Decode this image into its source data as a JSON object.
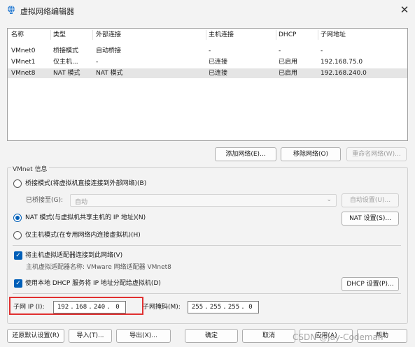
{
  "window": {
    "title": "虚拟网络编辑器",
    "close_glyph": "✕"
  },
  "table": {
    "columns": [
      "名称",
      "类型",
      "外部连接",
      "主机连接",
      "DHCP",
      "子网地址"
    ],
    "rows": [
      [
        "VMnet0",
        "桥接模式",
        "自动桥接",
        "-",
        "-",
        "-"
      ],
      [
        "VMnet1",
        "仅主机...",
        "-",
        "已连接",
        "已启用",
        "192.168.75.0"
      ],
      [
        "VMnet8",
        "NAT 模式",
        "NAT 模式",
        "已连接",
        "已启用",
        "192.168.240.0"
      ]
    ],
    "selected_row": 2
  },
  "network_buttons": {
    "add": "添加网络(E)...",
    "remove": "移除网络(O)",
    "rename": "重命名网络(W)..."
  },
  "vmnet_info": {
    "group_title": "VMnet 信息",
    "bridge_mode": "桥接模式(将虚拟机直接连接到外部网络)(B)",
    "bridged_to_label": "已桥接至(G):",
    "bridged_to_value": "自动",
    "auto_settings": "自动设置(U)...",
    "nat_mode": "NAT 模式(与虚拟机共享主机的 IP 地址)(N)",
    "nat_settings": "NAT 设置(S)...",
    "host_only": "仅主机模式(在专用网络内连接虚拟机)(H)",
    "connect_adapter": "将主机虚拟适配器连接到此网络(V)",
    "adapter_name": "主机虚拟适配器名称: VMware 网络适配器 VMnet8",
    "use_dhcp": "使用本地 DHCP 服务将 IP 地址分配给虚拟机(D)",
    "dhcp_settings": "DHCP 设置(P)...",
    "mode_selected": "nat",
    "connect_adapter_checked": true,
    "use_dhcp_checked": true
  },
  "subnet": {
    "ip_label": "子网 IP (I):",
    "ip_octets": [
      "192",
      "168",
      "240",
      "0"
    ],
    "mask_label": "子网掩码(M):",
    "mask_octets": [
      "255",
      "255",
      "255",
      "0"
    ]
  },
  "footer": {
    "restore": "还原默认设置(R)",
    "import": "导入(T)...",
    "export": "导出(X)...",
    "ok": "确定",
    "cancel": "取消",
    "apply": "应用(A)",
    "help": "帮助"
  },
  "watermark": "CSDN @Jay-Codeman",
  "colors": {
    "accent": "#005fb8",
    "highlight_border": "#e03030"
  },
  "icons": {
    "app": "network-globe-icon",
    "close": "close-icon",
    "chevron": "chevron-down-icon",
    "check": "checkmark-icon"
  }
}
